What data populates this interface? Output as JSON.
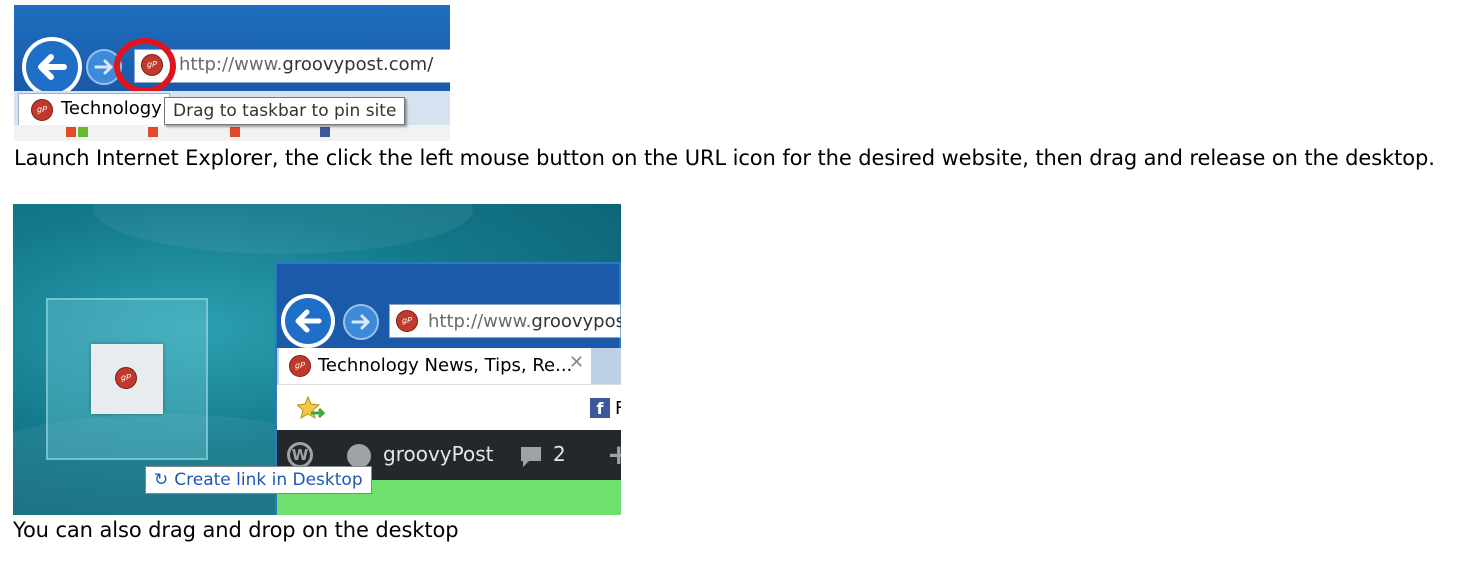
{
  "shot1": {
    "url_prefix": "http://www.",
    "url_domain": "groovypost.com/",
    "favicon_text": "gP",
    "tab_label": "Technology",
    "tooltip": "Drag to taskbar to pin site"
  },
  "caption1": "Launch Internet Explorer, the click the left mouse button on the URL icon for the desired website, then drag and release on the desktop.",
  "shot2": {
    "url_prefix": "http://www.",
    "url_domain": "groovypost",
    "favicon_text": "gP",
    "tab_label": "Technology News, Tips, Re...",
    "tab_close": "✕",
    "facebook_label": "Fa",
    "wp_site_name": "groovyPost",
    "wp_comment_count": "2",
    "drag_tip": "Create link in Desktop"
  },
  "caption2": "You can also drag and drop on the desktop",
  "colors": {
    "ie_blue": "#1a5aa8",
    "highlight_ring": "#e0141e",
    "favicon_red": "#c0392b",
    "wp_bar": "#23282d",
    "site_green": "#6ee06e",
    "desktop_teal": "#137a8c"
  }
}
